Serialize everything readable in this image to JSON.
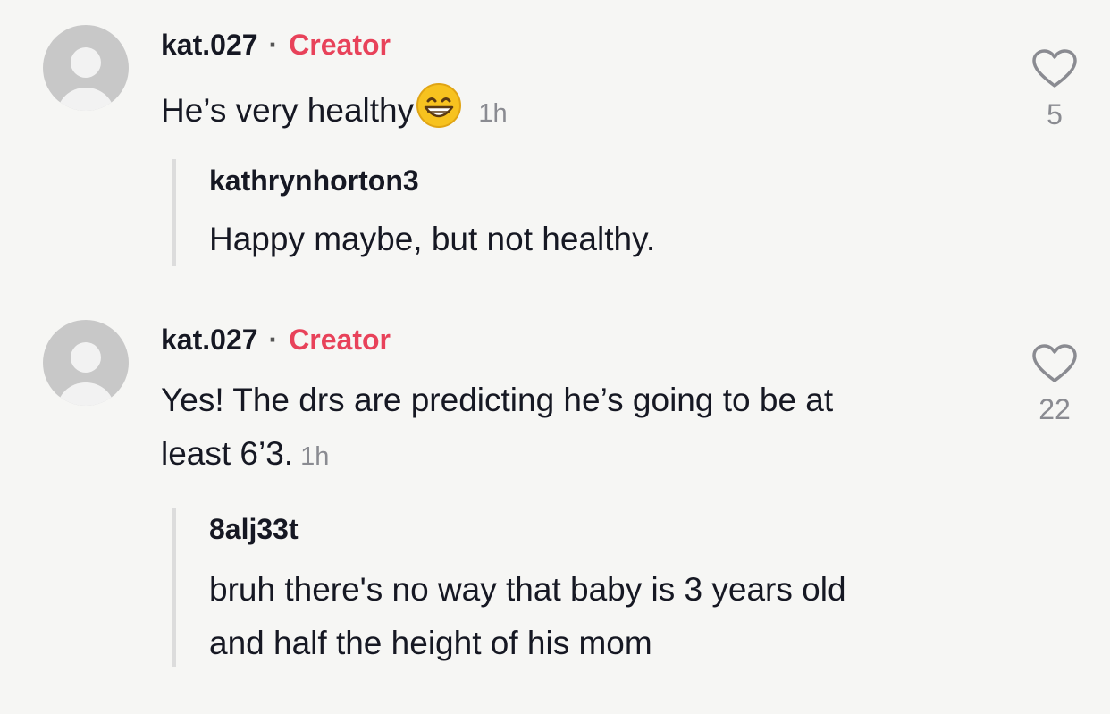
{
  "comments": [
    {
      "username": "kat.027",
      "separator": "·",
      "badge": "Creator",
      "text": "He’s very healthy",
      "emoji": "grinning-face-emoji",
      "time": "1h",
      "likes": "5",
      "reply": {
        "username": "kathrynhorton3",
        "text": "Happy maybe, but not healthy."
      }
    },
    {
      "username": "kat.027",
      "separator": "·",
      "badge": "Creator",
      "text_line1": "Yes! The drs are predicting he’s going to be at",
      "text_line2": "least 6’3.",
      "time": "1h",
      "likes": "22",
      "reply": {
        "username": "8alj33t",
        "text_line1": "bruh there's no way that baby is 3 years old",
        "text_line2": "and half the height of his mom"
      }
    }
  ],
  "colors": {
    "creator_badge": "#e8425a",
    "muted": "#8a8b91",
    "text": "#161823"
  }
}
